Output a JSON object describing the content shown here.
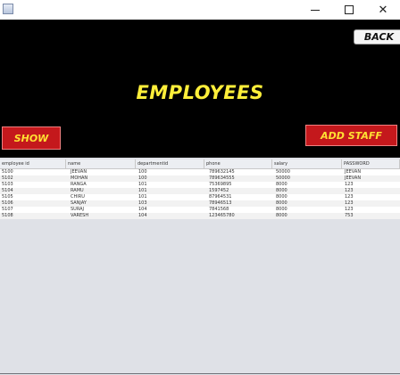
{
  "window": {
    "minimize_glyph": "—",
    "maximize_glyph": "☐",
    "close_glyph": "✕",
    "icons": [
      "app-icon",
      "minimize-icon",
      "maximize-icon",
      "close-icon"
    ]
  },
  "header": {
    "back_label": "BACK",
    "title": "EMPLOYEES",
    "show_label": "SHOW",
    "add_staff_label": "ADD STAFF"
  },
  "colors": {
    "panel_bg": "#000000",
    "title": "#ffef3a",
    "button_bg": "#c4181c",
    "button_text": "#ffe033",
    "window_bg": "#dfe1e7"
  },
  "table": {
    "columns": [
      "employee id",
      "name",
      "departmentid",
      "phone",
      "salary",
      "PASSWORD"
    ],
    "rows": [
      [
        "5100",
        "JEEVAN",
        "100",
        "789632145",
        "50000",
        "JEEVAN"
      ],
      [
        "5102",
        "MOHAN",
        "100",
        "789634555",
        "50000",
        "JEEVAN"
      ],
      [
        "5103",
        "RANGA",
        "101",
        "75369895",
        "8000",
        "123"
      ],
      [
        "5104",
        "RAMU",
        "101",
        "1597452",
        "8000",
        "123"
      ],
      [
        "5105",
        "CHIRU",
        "101",
        "87964531",
        "8000",
        "123"
      ],
      [
        "5106",
        "SANJAY",
        "103",
        "78946513",
        "8000",
        "123"
      ],
      [
        "5107",
        "SURAJ",
        "104",
        "7841568",
        "8000",
        "123"
      ],
      [
        "5108",
        "VARESH",
        "104",
        "123465780",
        "8000",
        "753"
      ]
    ]
  }
}
